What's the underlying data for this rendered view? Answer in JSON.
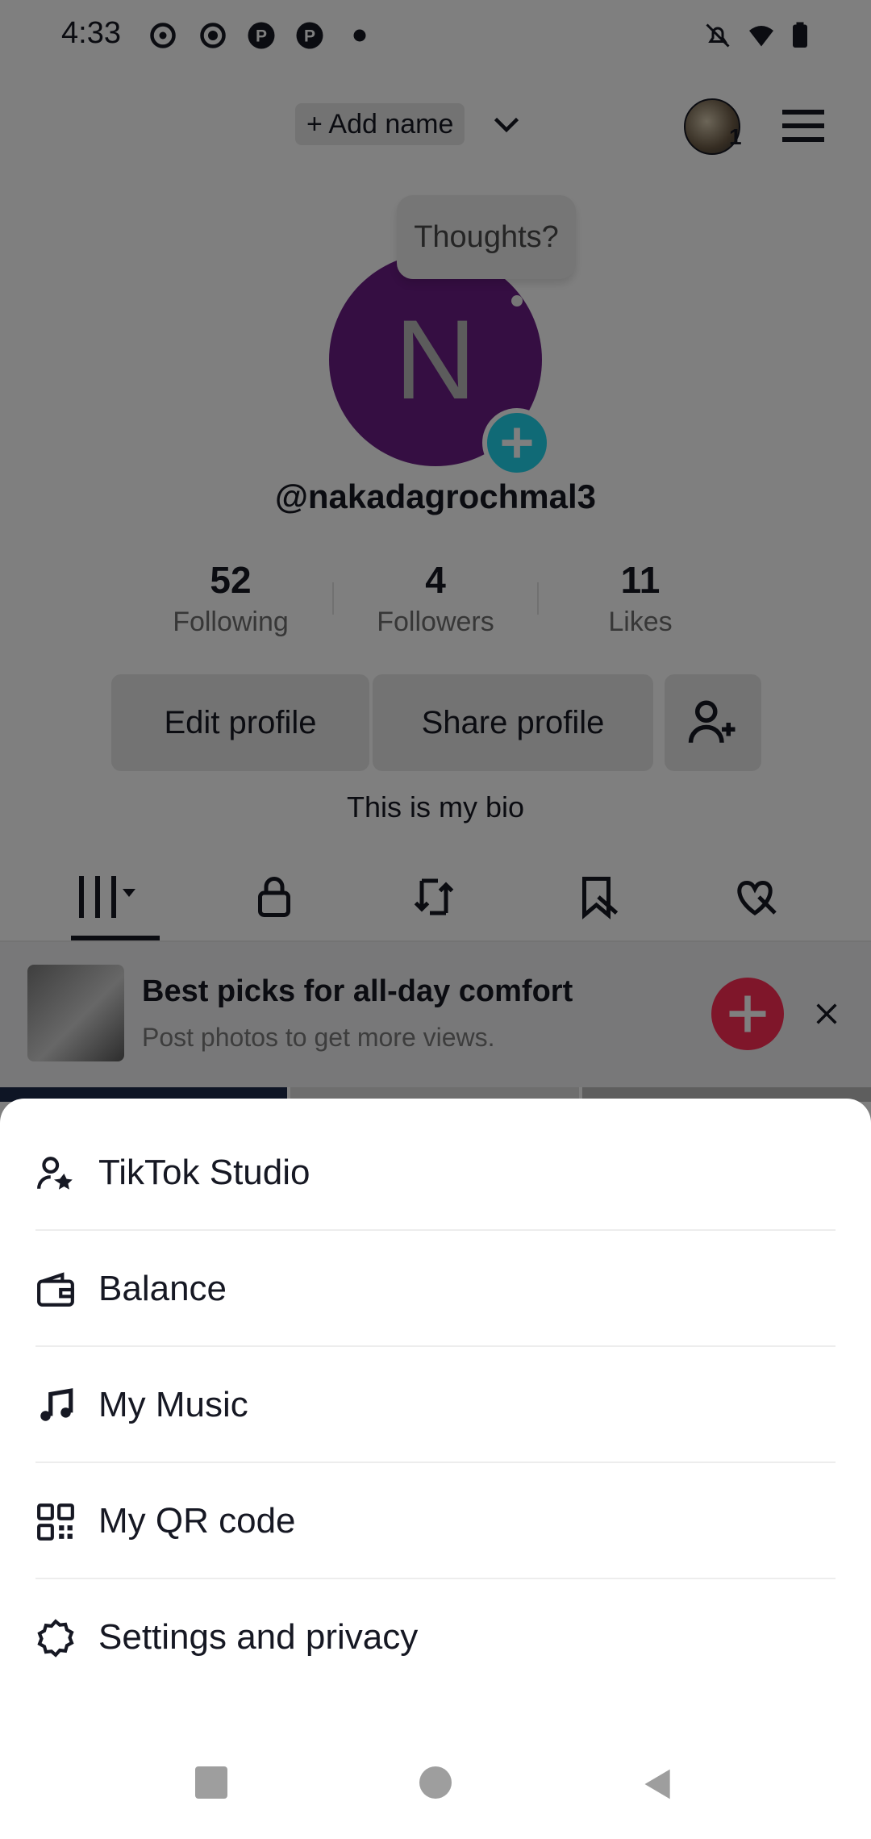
{
  "status_bar": {
    "time": "4:33",
    "icons": [
      "threads-icon",
      "circle-dot-icon",
      "pinterest-icon",
      "pinterest-icon",
      "dot-icon",
      "bell-off-icon",
      "wifi-icon",
      "battery-icon"
    ]
  },
  "header": {
    "add_name_label": "+ Add name",
    "badge_count": "1"
  },
  "profile": {
    "avatar_letter": "N",
    "thought_bubble": "Thoughts?",
    "username": "@nakadagrochmal3",
    "stats": [
      {
        "value": "52",
        "label": "Following"
      },
      {
        "value": "4",
        "label": "Followers"
      },
      {
        "value": "11",
        "label": "Likes"
      }
    ],
    "edit_profile_label": "Edit profile",
    "share_profile_label": "Share profile",
    "bio": "This is my bio"
  },
  "promo": {
    "title": "Best picks for all-day comfort",
    "subtitle": "Post photos to get more views."
  },
  "menu": {
    "items": [
      {
        "label": "TikTok Studio",
        "icon": "person-star-icon"
      },
      {
        "label": "Balance",
        "icon": "wallet-icon"
      },
      {
        "label": "My Music",
        "icon": "music-note-icon"
      },
      {
        "label": "My QR code",
        "icon": "qr-code-icon"
      },
      {
        "label": "Settings and privacy",
        "icon": "gear-icon"
      }
    ]
  },
  "colors": {
    "avatar_bg": "#6a1c84",
    "add_avatar_accent": "#20d5ec",
    "promo_add_button": "#fe2c55",
    "overlay": "rgba(0,0,0,0.5)"
  }
}
